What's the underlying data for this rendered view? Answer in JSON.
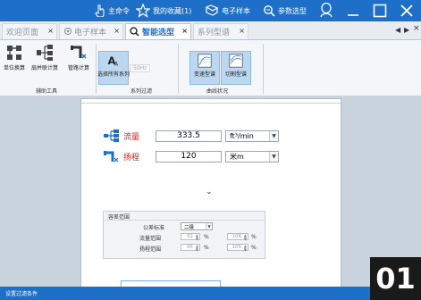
{
  "topbar": {
    "home_label": "主命令",
    "favorites_label": "我的收藏(1)",
    "ebook_label": "电子样本",
    "params_label": "参数选型"
  },
  "tabs": [
    {
      "label": "欢迎页面"
    },
    {
      "label": "电子样本"
    },
    {
      "label": "智能选型"
    },
    {
      "label": "系列型谱"
    }
  ],
  "ribbon": {
    "btn_unit": "单位换算",
    "btn_parallel": "扇并联计算",
    "btn_pipe": "管路计算",
    "group_aux": "辅助工具",
    "btn_select_all": "选择所有系列",
    "freq": "50Hz",
    "group_filter": "系列过滤",
    "btn_curve_a": "变速型谱",
    "btn_curve_b": "切割型谱",
    "group_curve": "曲线状况"
  },
  "form": {
    "flow_label": "流量",
    "flow_value": "333.5",
    "flow_unit": "ft³/min",
    "head_label": "扬程",
    "head_value": "120",
    "head_unit": "米m"
  },
  "tolerance": {
    "title": "容差范围",
    "std_label": "公差标准",
    "std_value": "二级",
    "flow_range_label": "流量范围",
    "flow_min": "92",
    "flow_max": "108",
    "head_range_label": "扬程范围",
    "head_min": "95",
    "head_max": "105",
    "pct": "%"
  },
  "status": {
    "text": "设置过滤条件"
  },
  "page_badge": "01",
  "colors": {
    "brand": "#1e6fc8",
    "label_red": "#d62020"
  }
}
